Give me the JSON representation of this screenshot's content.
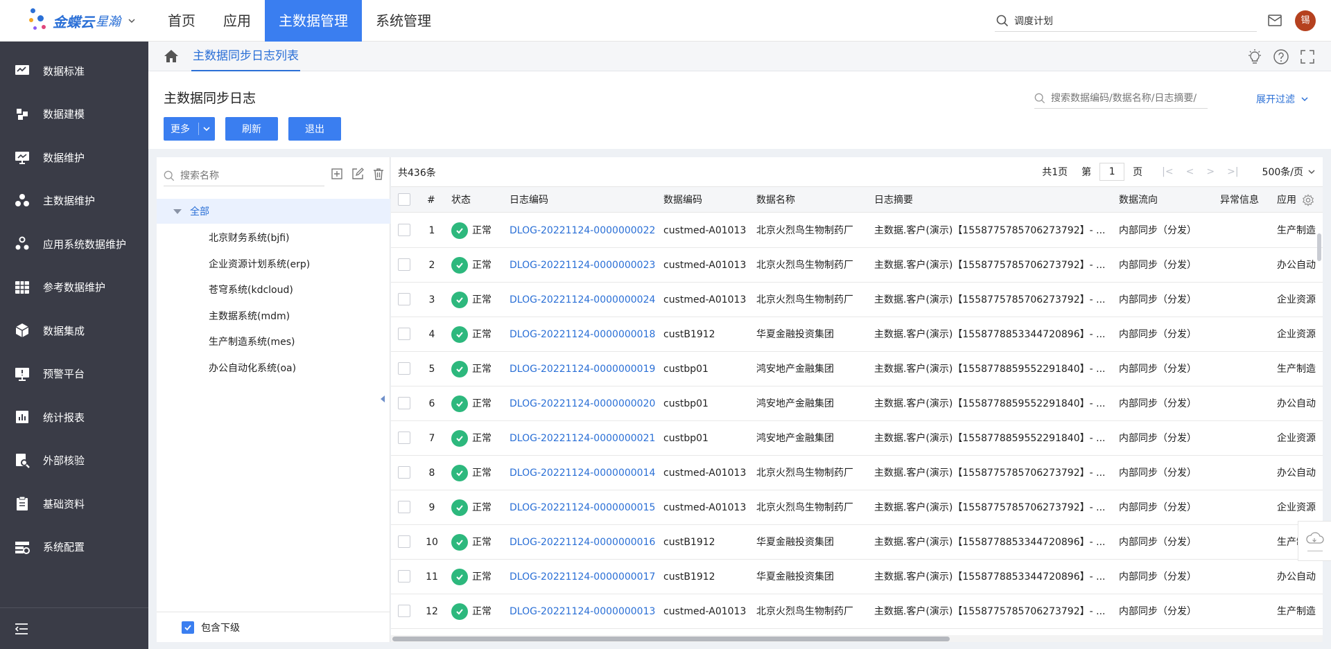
{
  "app": {
    "brand": "金蝶云",
    "brand_sub": "星瀚",
    "nav": [
      {
        "label": "首页"
      },
      {
        "label": "应用"
      },
      {
        "label": "主数据管理"
      },
      {
        "label": "系统管理"
      }
    ],
    "active_nav": "主数据管理",
    "search_value": "调度计划",
    "avatar_text": "锡"
  },
  "sidebar": {
    "items": [
      {
        "label": "数据标准",
        "icon": "chart-monitor-icon"
      },
      {
        "label": "数据建模",
        "icon": "puzzle-icon"
      },
      {
        "label": "数据维护",
        "icon": "monitor-icon"
      },
      {
        "label": "主数据维护",
        "icon": "cluster-icon"
      },
      {
        "label": "应用系统数据维护",
        "icon": "apps-cluster-icon"
      },
      {
        "label": "参考数据维护",
        "icon": "table-grid-icon"
      },
      {
        "label": "数据集成",
        "icon": "cube-icon"
      },
      {
        "label": "预警平台",
        "icon": "alert-screen-icon"
      },
      {
        "label": "统计报表",
        "icon": "bar-report-icon"
      },
      {
        "label": "外部核验",
        "icon": "search-doc-icon"
      },
      {
        "label": "基础资料",
        "icon": "clipboard-icon"
      },
      {
        "label": "系统配置",
        "icon": "config-list-icon"
      }
    ]
  },
  "breadcrumb": {
    "tab": "主数据同步日志列表"
  },
  "page": {
    "title": "主数据同步日志",
    "buttons": {
      "more": "更多",
      "refresh": "刷新",
      "exit": "退出"
    },
    "filter_placeholder": "搜索数据编码/数据名称/日志摘要/",
    "expand_filter": "展开过滤"
  },
  "tree": {
    "search_placeholder": "搜索名称",
    "root": "全部",
    "nodes": [
      "北京财务系统(bjfi)",
      "企业资源计划系统(erp)",
      "苍穹系统(kdcloud)",
      "主数据系统(mdm)",
      "生产制造系统(mes)",
      "办公自动化系统(oa)"
    ],
    "include_children": "包含下级"
  },
  "table": {
    "total": "共436条",
    "pager": {
      "pages_total": "共1页",
      "page_prefix": "第",
      "page": "1",
      "page_suffix": "页",
      "page_size": "500条/页"
    },
    "columns": {
      "index": "#",
      "status": "状态",
      "log_code": "日志编码",
      "data_code": "数据编码",
      "data_name": "数据名称",
      "summary": "日志摘要",
      "flow": "数据流向",
      "error": "异常信息",
      "app": "应用"
    },
    "rows": [
      {
        "idx": "1",
        "status": "正常",
        "log_code": "DLOG-20221124-0000000022",
        "data_code": "custmed-A01013",
        "data_name": "北京火烈鸟生物制药厂",
        "summary": "主数据.客户(演示)【1558775785706273792】- ...",
        "flow": "内部同步（分发）",
        "error": "",
        "app": "生产制造"
      },
      {
        "idx": "2",
        "status": "正常",
        "log_code": "DLOG-20221124-0000000023",
        "data_code": "custmed-A01013",
        "data_name": "北京火烈鸟生物制药厂",
        "summary": "主数据.客户(演示)【1558775785706273792】- ...",
        "flow": "内部同步（分发）",
        "error": "",
        "app": "办公自动"
      },
      {
        "idx": "3",
        "status": "正常",
        "log_code": "DLOG-20221124-0000000024",
        "data_code": "custmed-A01013",
        "data_name": "北京火烈鸟生物制药厂",
        "summary": "主数据.客户(演示)【1558775785706273792】- ...",
        "flow": "内部同步（分发）",
        "error": "",
        "app": "企业资源"
      },
      {
        "idx": "4",
        "status": "正常",
        "log_code": "DLOG-20221124-0000000018",
        "data_code": "custB1912",
        "data_name": "华夏金融投资集团",
        "summary": "主数据.客户(演示)【1558778853344720896】- ...",
        "flow": "内部同步（分发）",
        "error": "",
        "app": "企业资源"
      },
      {
        "idx": "5",
        "status": "正常",
        "log_code": "DLOG-20221124-0000000019",
        "data_code": "custbp01",
        "data_name": "鸿安地产金融集团",
        "summary": "主数据.客户(演示)【1558778859552291840】- ...",
        "flow": "内部同步（分发）",
        "error": "",
        "app": "生产制造"
      },
      {
        "idx": "6",
        "status": "正常",
        "log_code": "DLOG-20221124-0000000020",
        "data_code": "custbp01",
        "data_name": "鸿安地产金融集团",
        "summary": "主数据.客户(演示)【1558778859552291840】- ...",
        "flow": "内部同步（分发）",
        "error": "",
        "app": "办公自动"
      },
      {
        "idx": "7",
        "status": "正常",
        "log_code": "DLOG-20221124-0000000021",
        "data_code": "custbp01",
        "data_name": "鸿安地产金融集团",
        "summary": "主数据.客户(演示)【1558778859552291840】- ...",
        "flow": "内部同步（分发）",
        "error": "",
        "app": "企业资源"
      },
      {
        "idx": "8",
        "status": "正常",
        "log_code": "DLOG-20221124-0000000014",
        "data_code": "custmed-A01013",
        "data_name": "北京火烈鸟生物制药厂",
        "summary": "主数据.客户(演示)【1558775785706273792】- ...",
        "flow": "内部同步（分发）",
        "error": "",
        "app": "办公自动"
      },
      {
        "idx": "9",
        "status": "正常",
        "log_code": "DLOG-20221124-0000000015",
        "data_code": "custmed-A01013",
        "data_name": "北京火烈鸟生物制药厂",
        "summary": "主数据.客户(演示)【1558775785706273792】- ...",
        "flow": "内部同步（分发）",
        "error": "",
        "app": "企业资源"
      },
      {
        "idx": "10",
        "status": "正常",
        "log_code": "DLOG-20221124-0000000016",
        "data_code": "custB1912",
        "data_name": "华夏金融投资集团",
        "summary": "主数据.客户(演示)【1558778853344720896】- ...",
        "flow": "内部同步（分发）",
        "error": "",
        "app": "生产制"
      },
      {
        "idx": "11",
        "status": "正常",
        "log_code": "DLOG-20221124-0000000017",
        "data_code": "custB1912",
        "data_name": "华夏金融投资集团",
        "summary": "主数据.客户(演示)【1558778853344720896】- ...",
        "flow": "内部同步（分发）",
        "error": "",
        "app": "办公自动"
      },
      {
        "idx": "12",
        "status": "正常",
        "log_code": "DLOG-20221124-0000000013",
        "data_code": "custmed-A01013",
        "data_name": "北京火烈鸟生物制药厂",
        "summary": "主数据.客户(演示)【1558775785706273792】- ...",
        "flow": "内部同步（分发）",
        "error": "",
        "app": "生产制造"
      }
    ]
  },
  "colors": {
    "primary": "#3a7ef0",
    "link": "#2a6fd6",
    "sidebar_bg": "#3a3c47",
    "status_ok": "#2db87d"
  }
}
